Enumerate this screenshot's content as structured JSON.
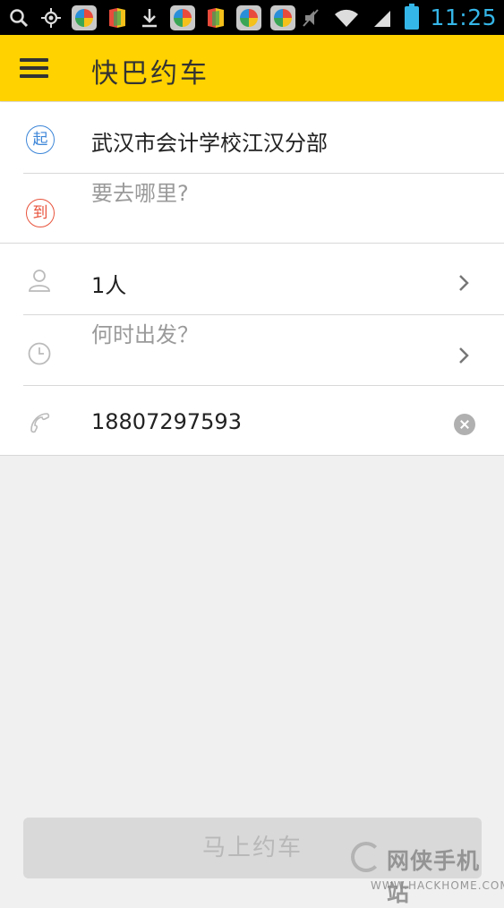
{
  "status_bar": {
    "time": "11:25",
    "icons": [
      "search-icon",
      "gps-icon",
      "app-icon",
      "app-icon",
      "download-icon",
      "app-icon",
      "app-icon",
      "app-icon",
      "app-icon",
      "mute-icon",
      "wifi-icon",
      "signal-icon",
      "battery-icon"
    ]
  },
  "app_bar": {
    "title": "快巴约车",
    "menu_icon": "hamburger-menu-icon",
    "background": "#ffd200"
  },
  "route": {
    "start_badge": "起",
    "start_value": "武汉市会计学校江汉分部",
    "end_badge": "到",
    "end_placeholder": "要去哪里?"
  },
  "details": {
    "passengers_value": "1人",
    "time_placeholder": "何时出发？",
    "phone_value": "18807297593"
  },
  "actions": {
    "submit_label": "马上约车"
  },
  "watermark": {
    "brand": "网侠手机站",
    "url": "WWW.HACKHOME.COM"
  }
}
